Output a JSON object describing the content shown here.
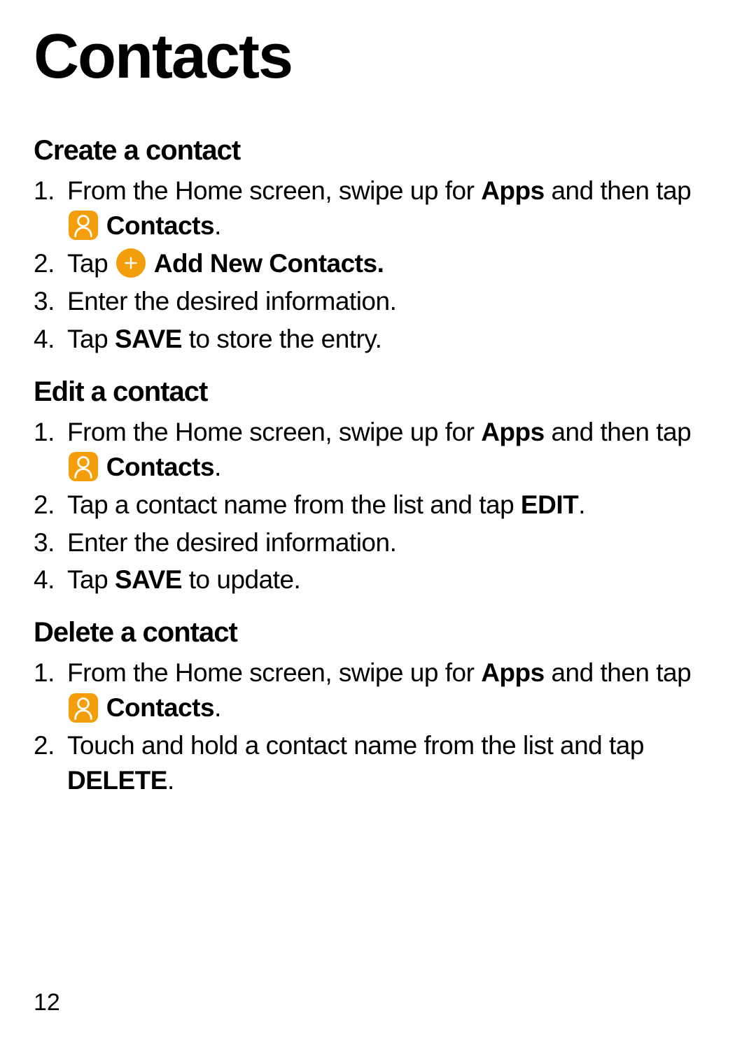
{
  "page": {
    "title": "Contacts",
    "number": "12"
  },
  "sections": {
    "create": {
      "heading": "Create a contact",
      "step1_part1": "From the Home screen, swipe up for ",
      "step1_apps": "Apps",
      "step1_part2": " and then tap ",
      "step1_contacts": "Contacts",
      "step1_part3": ".",
      "step2_part1": "Tap ",
      "step2_add": "Add New Contacts.",
      "step3": "Enter the desired information.",
      "step4_part1": "Tap ",
      "step4_save": "SAVE",
      "step4_part2": " to store the entry."
    },
    "edit": {
      "heading": "Edit a contact",
      "step1_part1": "From the Home screen, swipe up for ",
      "step1_apps": "Apps",
      "step1_part2": " and then tap ",
      "step1_contacts": "Contacts",
      "step1_part3": ".",
      "step2_part1": "Tap a contact name from the list and tap ",
      "step2_edit": "EDIT",
      "step2_part2": ".",
      "step3": "Enter the desired information.",
      "step4_part1": "Tap ",
      "step4_save": "SAVE",
      "step4_part2": " to update."
    },
    "delete": {
      "heading": "Delete a contact",
      "step1_part1": "From the Home screen, swipe up for ",
      "step1_apps": "Apps",
      "step1_part2": " and then tap ",
      "step1_contacts": "Contacts",
      "step1_part3": ".",
      "step2_part1": "Touch and hold a contact name from the list and tap ",
      "step2_delete": "DELETE",
      "step2_part2": "."
    }
  },
  "colors": {
    "accent": "#f59e0b"
  }
}
